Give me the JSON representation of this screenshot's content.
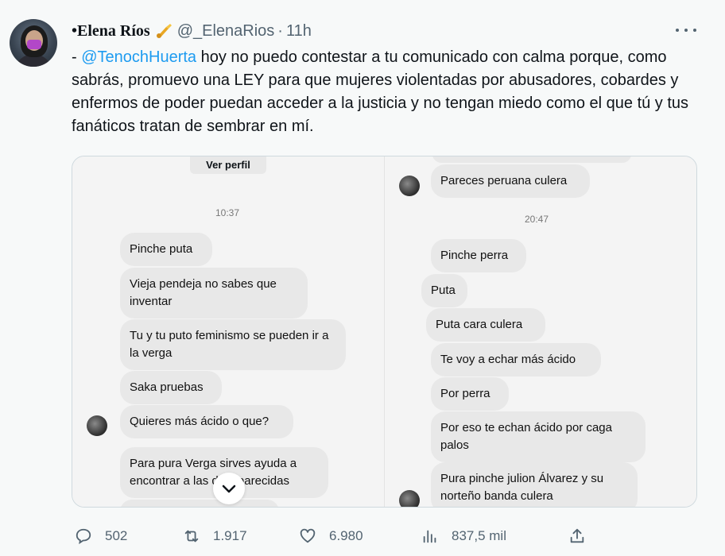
{
  "tweet": {
    "author_name": "•Elena Ríos",
    "handle": "@_ElenaRios",
    "separator": "·",
    "time": "11h",
    "text_prefix": "- ",
    "mention": "@TenochHuerta",
    "text_rest": " hoy no puedo contestar a tu comunicado con calma porque, como sabrás, promuevo una LEY para que mujeres violentadas por abusadores, cobardes y enfermos de poder puedan acceder a la justicia y no tengan miedo como el que tú y tus fanáticos tratan de sembrar en mí."
  },
  "media": {
    "left": {
      "ver_perfil": "Ver perfil",
      "timestamp": "10:37",
      "messages": [
        "Pinche puta",
        "Vieja pendeja no sabes que inventar",
        "Tu y tu puto feminismo se pueden ir a la verga",
        "Saka pruebas",
        "Quieres más ácido o que?",
        "Para pura Verga sirves ayuda a encontrar a las desaparecidas"
      ]
    },
    "right": {
      "top_message": "Pareces peruana culera",
      "timestamp": "20:47",
      "messages": [
        "Pinche perra",
        "Puta",
        "Puta cara culera",
        "Te voy a echar más ácido",
        "Por perra",
        "Por eso te echan ácido por caga palos",
        "Pura pinche julion Álvarez y su norteño banda culera"
      ]
    }
  },
  "actions": {
    "replies": "502",
    "retweets": "1.917",
    "likes": "6.980",
    "views": "837,5 mil"
  },
  "icons": {
    "badge": "saxophone-emoji-icon",
    "more": "more-icon",
    "reply": "reply-icon",
    "retweet": "retweet-icon",
    "like": "heart-icon",
    "views": "views-icon",
    "share": "share-icon",
    "chevron": "chevron-down-icon"
  },
  "colors": {
    "link": "#1d9bf0",
    "secondary_text": "#536471",
    "background": "#f7f9f9"
  }
}
